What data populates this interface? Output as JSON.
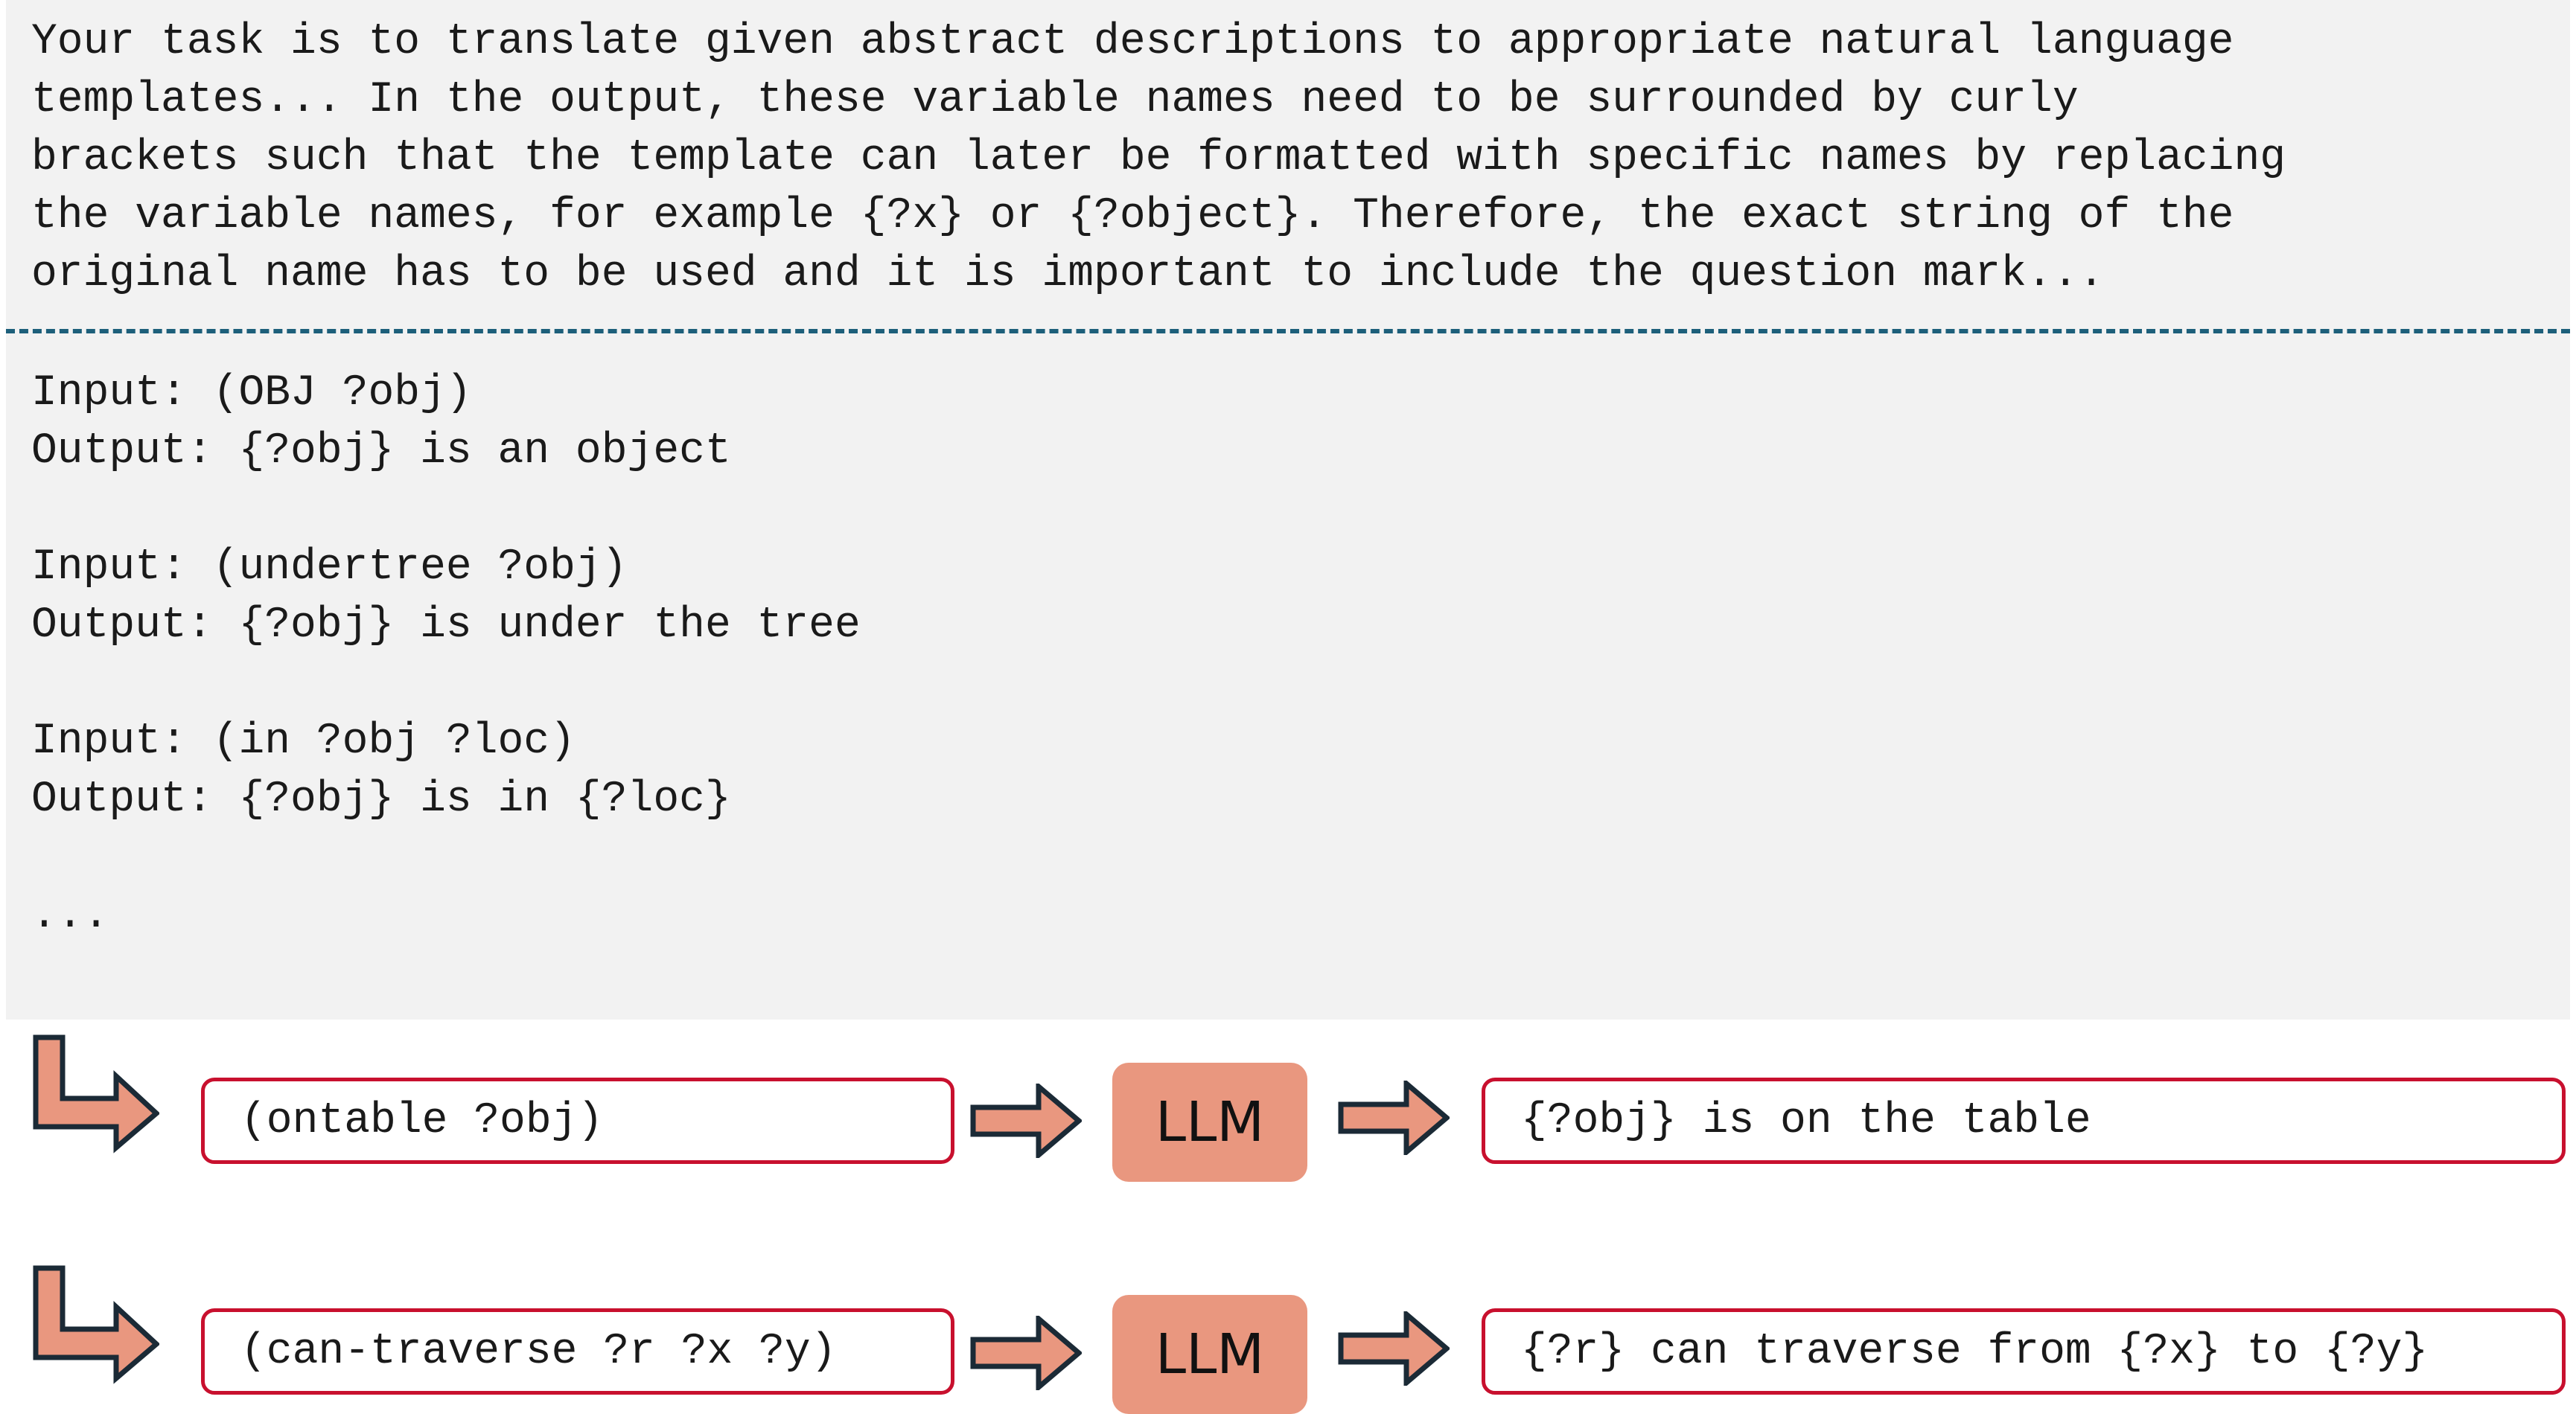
{
  "prompt": {
    "instruction_lines": [
      "Your task is to translate given abstract descriptions to appropriate natural language",
      "templates... In the output, these variable names need to be surrounded by curly",
      "brackets such that the template can later be formatted with specific names by replacing",
      "the variable names, for example {?x} or {?object}. Therefore, the exact string of the",
      "original name has to be used and it is important to include the question mark..."
    ],
    "example_lines": [
      "Input: (OBJ ?obj)",
      "Output: {?obj} is an object",
      "",
      "Input: (undertree ?obj)",
      "Output: {?obj} is under the tree",
      "",
      "Input: (in ?obj ?loc)",
      "Output: {?obj} is in {?loc}",
      "",
      "..."
    ]
  },
  "flows": [
    {
      "input": "(ontable ?obj)",
      "model": "LLM",
      "output": "{?obj} is on the table"
    },
    {
      "input": "(can-traverse ?r ?x ?y)",
      "model": "LLM",
      "output": "{?r} can traverse from {?x} to {?y}"
    }
  ],
  "colors": {
    "panel_background": "#f2f2f2",
    "divider": "#1d5f7a",
    "box_border": "#c8102e",
    "arrow_fill": "#e9977f",
    "arrow_stroke": "#1b2a36",
    "llm_fill": "#e9977f"
  }
}
